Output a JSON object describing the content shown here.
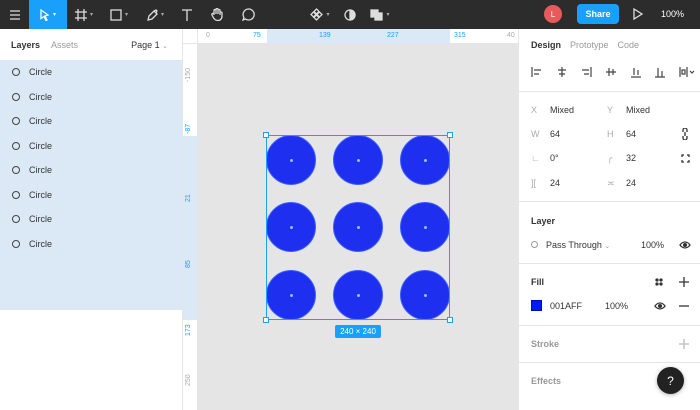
{
  "toolbar": {
    "avatar_initial": "L",
    "share_label": "Share",
    "zoom_level": "100%"
  },
  "layers_panel": {
    "tabs": [
      "Layers",
      "Assets"
    ],
    "page_selector": "Page 1",
    "layers": [
      "Circle",
      "Circle",
      "Circle",
      "Circle",
      "Circle",
      "Circle",
      "Circle",
      "Circle"
    ]
  },
  "rulers": {
    "top": [
      "0",
      "75",
      "139",
      "227",
      "315",
      "40"
    ],
    "left": [
      "-150",
      "-87",
      "21",
      "85",
      "173",
      "250"
    ]
  },
  "canvas": {
    "selection_size": "240 × 240",
    "circle_color": "#1f2ff0",
    "selection_color": "#18a0fb"
  },
  "design_panel": {
    "tabs": [
      "Design",
      "Prototype",
      "Code"
    ],
    "x_label": "X",
    "x_value": "Mixed",
    "y_label": "Y",
    "y_value": "Mixed",
    "w_label": "W",
    "w_value": "64",
    "h_label": "H",
    "h_value": "64",
    "rotation_value": "0°",
    "radius_value": "32",
    "spacing_h": "24",
    "spacing_v": "24",
    "layer_title": "Layer",
    "blend_mode": "Pass Through",
    "layer_opacity": "100%",
    "fill_title": "Fill",
    "fill_hex": "001AFF",
    "fill_opacity": "100%",
    "fill_color": "#001aff",
    "stroke_title": "Stroke",
    "effects_title": "Effects"
  },
  "help_label": "?"
}
